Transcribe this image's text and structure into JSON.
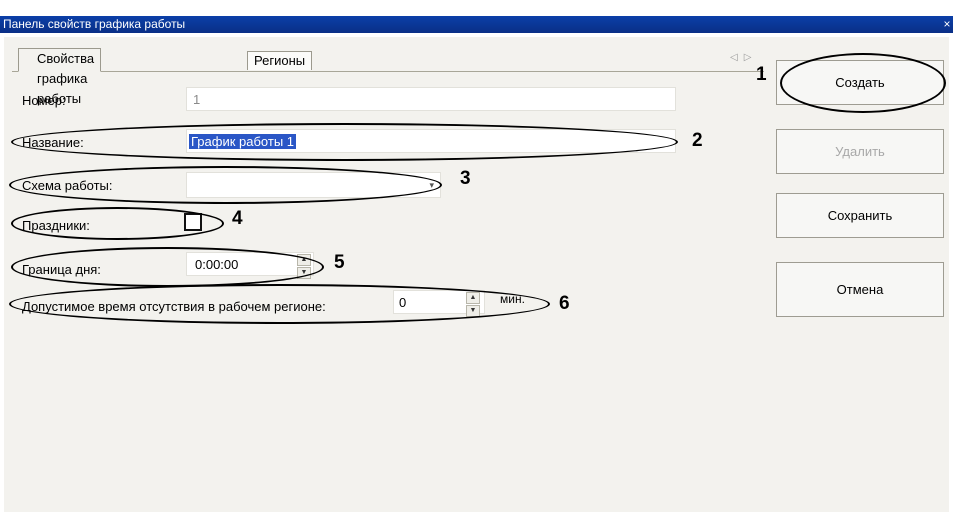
{
  "window": {
    "title": "Панель свойств графика работы",
    "close_glyph": "×"
  },
  "tabs": [
    {
      "label": "Свойства графика работы"
    },
    {
      "label": "Регионы"
    }
  ],
  "tab_scroll": {
    "left": "◁",
    "right": "▷"
  },
  "form": {
    "number": {
      "label": "Номер:",
      "value": "1"
    },
    "name": {
      "label": "Название:",
      "value": "График работы 1"
    },
    "scheme": {
      "label": "Схема работы:",
      "value": "",
      "arrow": "▾"
    },
    "holidays": {
      "label": "Праздники:",
      "checked": false
    },
    "day_border": {
      "label": "Граница дня:",
      "value": "0:00:00"
    },
    "absence": {
      "label": "Допустимое время отсутствия в рабочем регионе:",
      "value": "0",
      "unit": "мин."
    }
  },
  "buttons": {
    "create": "Создать",
    "delete": "Удалить",
    "save": "Сохранить",
    "cancel": "Отмена"
  },
  "callouts": [
    "1",
    "2",
    "3",
    "4",
    "5",
    "6"
  ]
}
